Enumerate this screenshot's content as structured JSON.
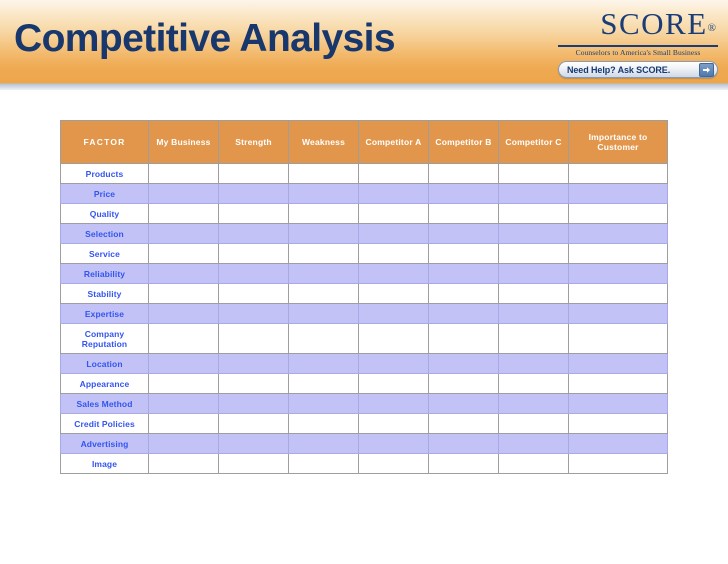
{
  "banner": {
    "title": "Competitive Analysis",
    "accent_color": "#eda64c",
    "title_color": "#17376d"
  },
  "logo": {
    "wordmark": "SCORE",
    "registered_mark": "®",
    "tagline": "Counselors to America's Small Business",
    "help_button_label": "Need Help? Ask SCORE.",
    "arrow_icon": "arrow-right-icon"
  },
  "table": {
    "headers": [
      "FACTOR",
      "My Business",
      "Strength",
      "Weakness",
      "Competitor A",
      "Competitor B",
      "Competitor C",
      "Importance to Customer"
    ],
    "header_bg": "#e2964b",
    "header_text_color": "#ffffff",
    "alt_row_bg": "#c2c2f7",
    "factor_text_color": "#3355ee",
    "rows": [
      {
        "factor": "Products"
      },
      {
        "factor": "Price"
      },
      {
        "factor": "Quality"
      },
      {
        "factor": "Selection"
      },
      {
        "factor": "Service"
      },
      {
        "factor": "Reliability"
      },
      {
        "factor": "Stability"
      },
      {
        "factor": "Expertise"
      },
      {
        "factor": "Company Reputation"
      },
      {
        "factor": "Location"
      },
      {
        "factor": "Appearance"
      },
      {
        "factor": "Sales Method"
      },
      {
        "factor": "Credit Policies"
      },
      {
        "factor": "Advertising"
      },
      {
        "factor": "Image"
      }
    ]
  }
}
